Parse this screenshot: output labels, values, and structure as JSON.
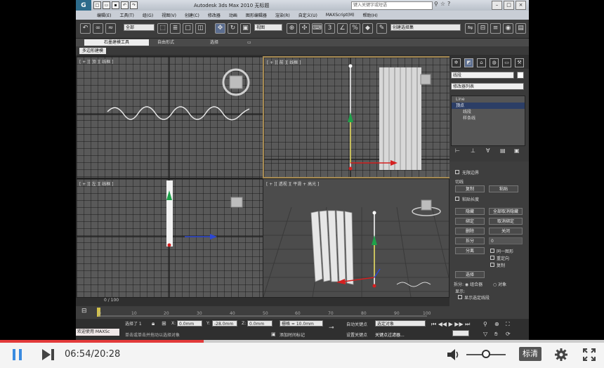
{
  "app": {
    "logo": "G",
    "title": "Autodesk 3ds Max  2010   无标题",
    "search_placeholder": "键入关键字或短语",
    "menus": [
      "编辑(E)",
      "工具(T)",
      "组(G)",
      "视图(V)",
      "创建(C)",
      "修改器",
      "动画",
      "图形编辑器",
      "渲染(R)",
      "自定义(U)",
      "MAXScript(M)",
      "帮助(H)"
    ],
    "toolbar": {
      "selection_filter": "全部",
      "ref_coord": "视图",
      "named_sel": "创建选择集"
    },
    "ribbon_tabs": [
      "石墨建模工具",
      "自由形式",
      "选择"
    ],
    "ribbon_sub": "多边形建模"
  },
  "viewports": {
    "top": "[ + ][ 顶 ][ 线框 ]",
    "front": "[ + ][ 前 ][ 线框 ]",
    "left": "[ + ][ 左 ][ 线框 ]",
    "persp": "[ + ][ 透视 ][ 平滑 + 高光 ]"
  },
  "command_panel": {
    "name_field": "线段",
    "modifier_list": "修改器列表",
    "stack": [
      "Line",
      "顶点",
      "线段",
      "样条线"
    ],
    "stack_selected": 1,
    "rollout": {
      "bezier_edge": "无限边界",
      "section_label": "切线",
      "copy": "复制",
      "paste": "粘贴",
      "paste_length": "粘贴长度",
      "hide": "隐藏",
      "unhide_all": "全部取消隐藏",
      "bind": "绑定",
      "unbind": "取消绑定",
      "delete": "删除",
      "close": "关闭",
      "divide": "拆分",
      "divide_value": "0",
      "detach": "分离",
      "same_shape": "同一图形",
      "reorient": "重定向",
      "copy_chk": "复制",
      "select_label": "选择",
      "display_label": "显示:",
      "show_selected": "显示选定线段",
      "radio_a": "拆分: ◉ 组合器",
      "radio_b": "○ 对象"
    }
  },
  "timeline": {
    "frame": "0 / 100",
    "ticks": [
      "0",
      "10",
      "20",
      "30",
      "40",
      "50",
      "60",
      "70",
      "80",
      "90",
      "100"
    ]
  },
  "status": {
    "welcome": "欢迎使用 MAXSc",
    "selected": "选择了 1 ",
    "x": "0.0mm",
    "y": "-28.0mm",
    "z": "0.0mm",
    "grid": "栅格 = 10.0mm",
    "hint": "单击或单击并拖动以选择对象",
    "add_tag": "添加时间标记",
    "auto_key": "自动关键点",
    "selected_obj": "选定对象",
    "set_key": "设置关键点",
    "key_filter": "关键点过滤器..."
  },
  "player": {
    "time": "06:54/20:28",
    "progress": 0.337,
    "quality": "标清",
    "volume": 0.5
  }
}
